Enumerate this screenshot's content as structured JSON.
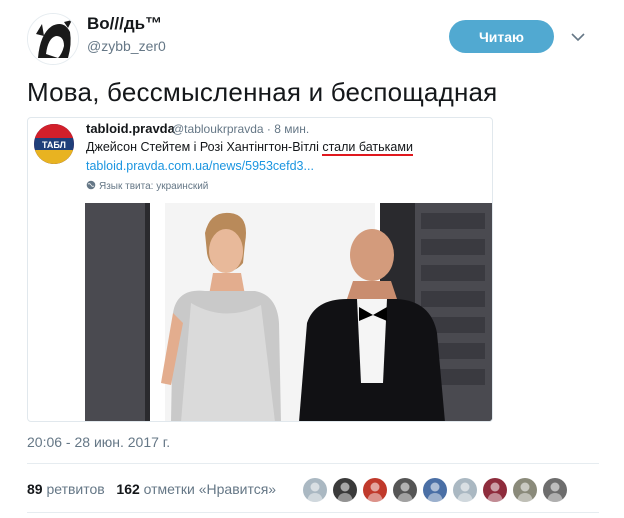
{
  "author": {
    "display_name": "Во///дь™",
    "handle": "@zybb_zer0"
  },
  "follow_button": {
    "label": "Читаю"
  },
  "tweet": {
    "text": "Мова, бессмысленная и беспощадная",
    "timestamp": "20:06 - 28 июн. 2017 г."
  },
  "quoted_tweet": {
    "name": "tabloid.pravda",
    "handle_time": "@tabloukrpravda · 8 мин.",
    "text_before": "Джейсон Стейтем і Розі Хантінгтон-Вітлі ",
    "text_highlight": "стали батьками",
    "link": "tabloid.pravda.com.ua/news/5953cefd3...",
    "language_note": "Язык твита: украинский",
    "avatar_text": "ТАБЛ"
  },
  "stats": {
    "retweets_count": "89",
    "retweets_label": "ретвитов",
    "likes_count": "162",
    "likes_label": "отметки «Нравится»"
  },
  "likers": [
    {
      "color": "#aab8c2"
    },
    {
      "color": "#3a3a3a"
    },
    {
      "color": "#c0392b"
    },
    {
      "color": "#555555"
    },
    {
      "color": "#4a6fa5"
    },
    {
      "color": "#aab8c2"
    },
    {
      "color": "#8e2c3c"
    },
    {
      "color": "#8a8a7a"
    },
    {
      "color": "#6d6d6d"
    }
  ],
  "colors": {
    "follow_button": "#51a9d1",
    "link": "#1b95e0",
    "highlight_underline": "#e0181e"
  }
}
